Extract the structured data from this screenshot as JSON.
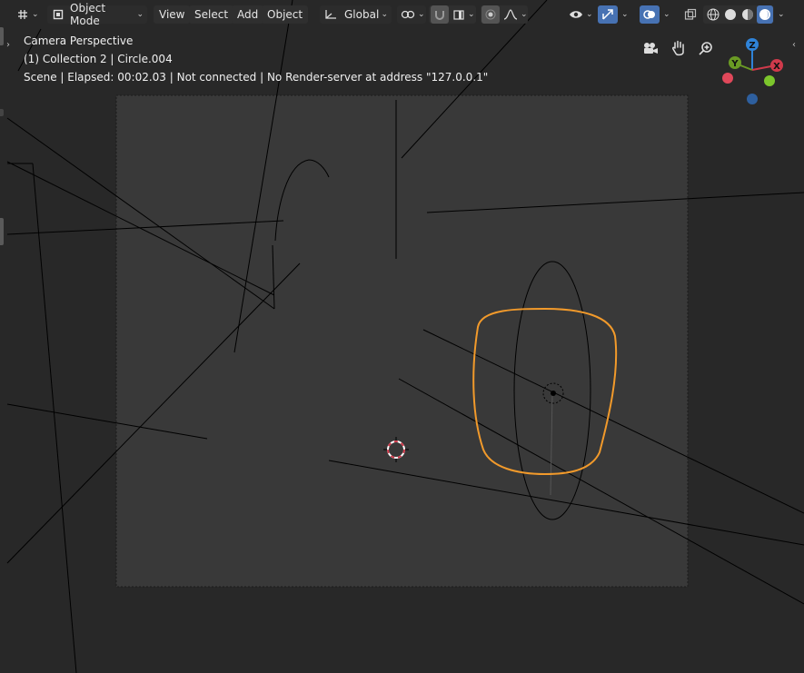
{
  "header": {
    "editor_type_icon": "editor-type-icon",
    "mode_label": "Object Mode",
    "menu": {
      "view": "View",
      "select": "Select",
      "add": "Add",
      "object": "Object"
    },
    "transform_orientation": "Global"
  },
  "overlay": {
    "view_name": "Camera Perspective",
    "collection_info": "(1) Collection 2 | Circle.004",
    "status": "Scene | Elapsed: 00:02.03 | Not connected | No Render-server at address \"127.0.0.1\""
  },
  "gizmo": {
    "x": "X",
    "y": "Y",
    "z": "Z"
  },
  "colors": {
    "background": "#282828",
    "camera_frame": "#393939",
    "selected_object": "#f29a2b",
    "active_button": "#4772b3",
    "axis_x": "#d03a4b",
    "axis_y": "#6a9a24",
    "axis_z": "#2f83d8"
  }
}
